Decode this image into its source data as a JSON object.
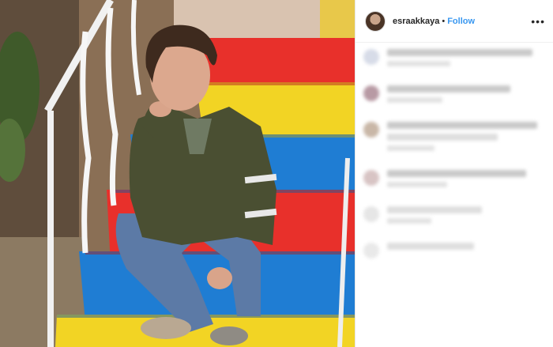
{
  "post": {
    "username": "esraakkaya",
    "separator": "•",
    "follow_label": "Follow",
    "more_label": "•••"
  },
  "colors": {
    "follow_blue": "#3897f0",
    "step_red": "#e8302b",
    "step_yellow": "#f2d424",
    "step_blue": "#1f7dd3",
    "jacket_olive": "#4a4f32"
  },
  "icons": {
    "more": "more-options-icon",
    "avatar": "profile-avatar"
  }
}
